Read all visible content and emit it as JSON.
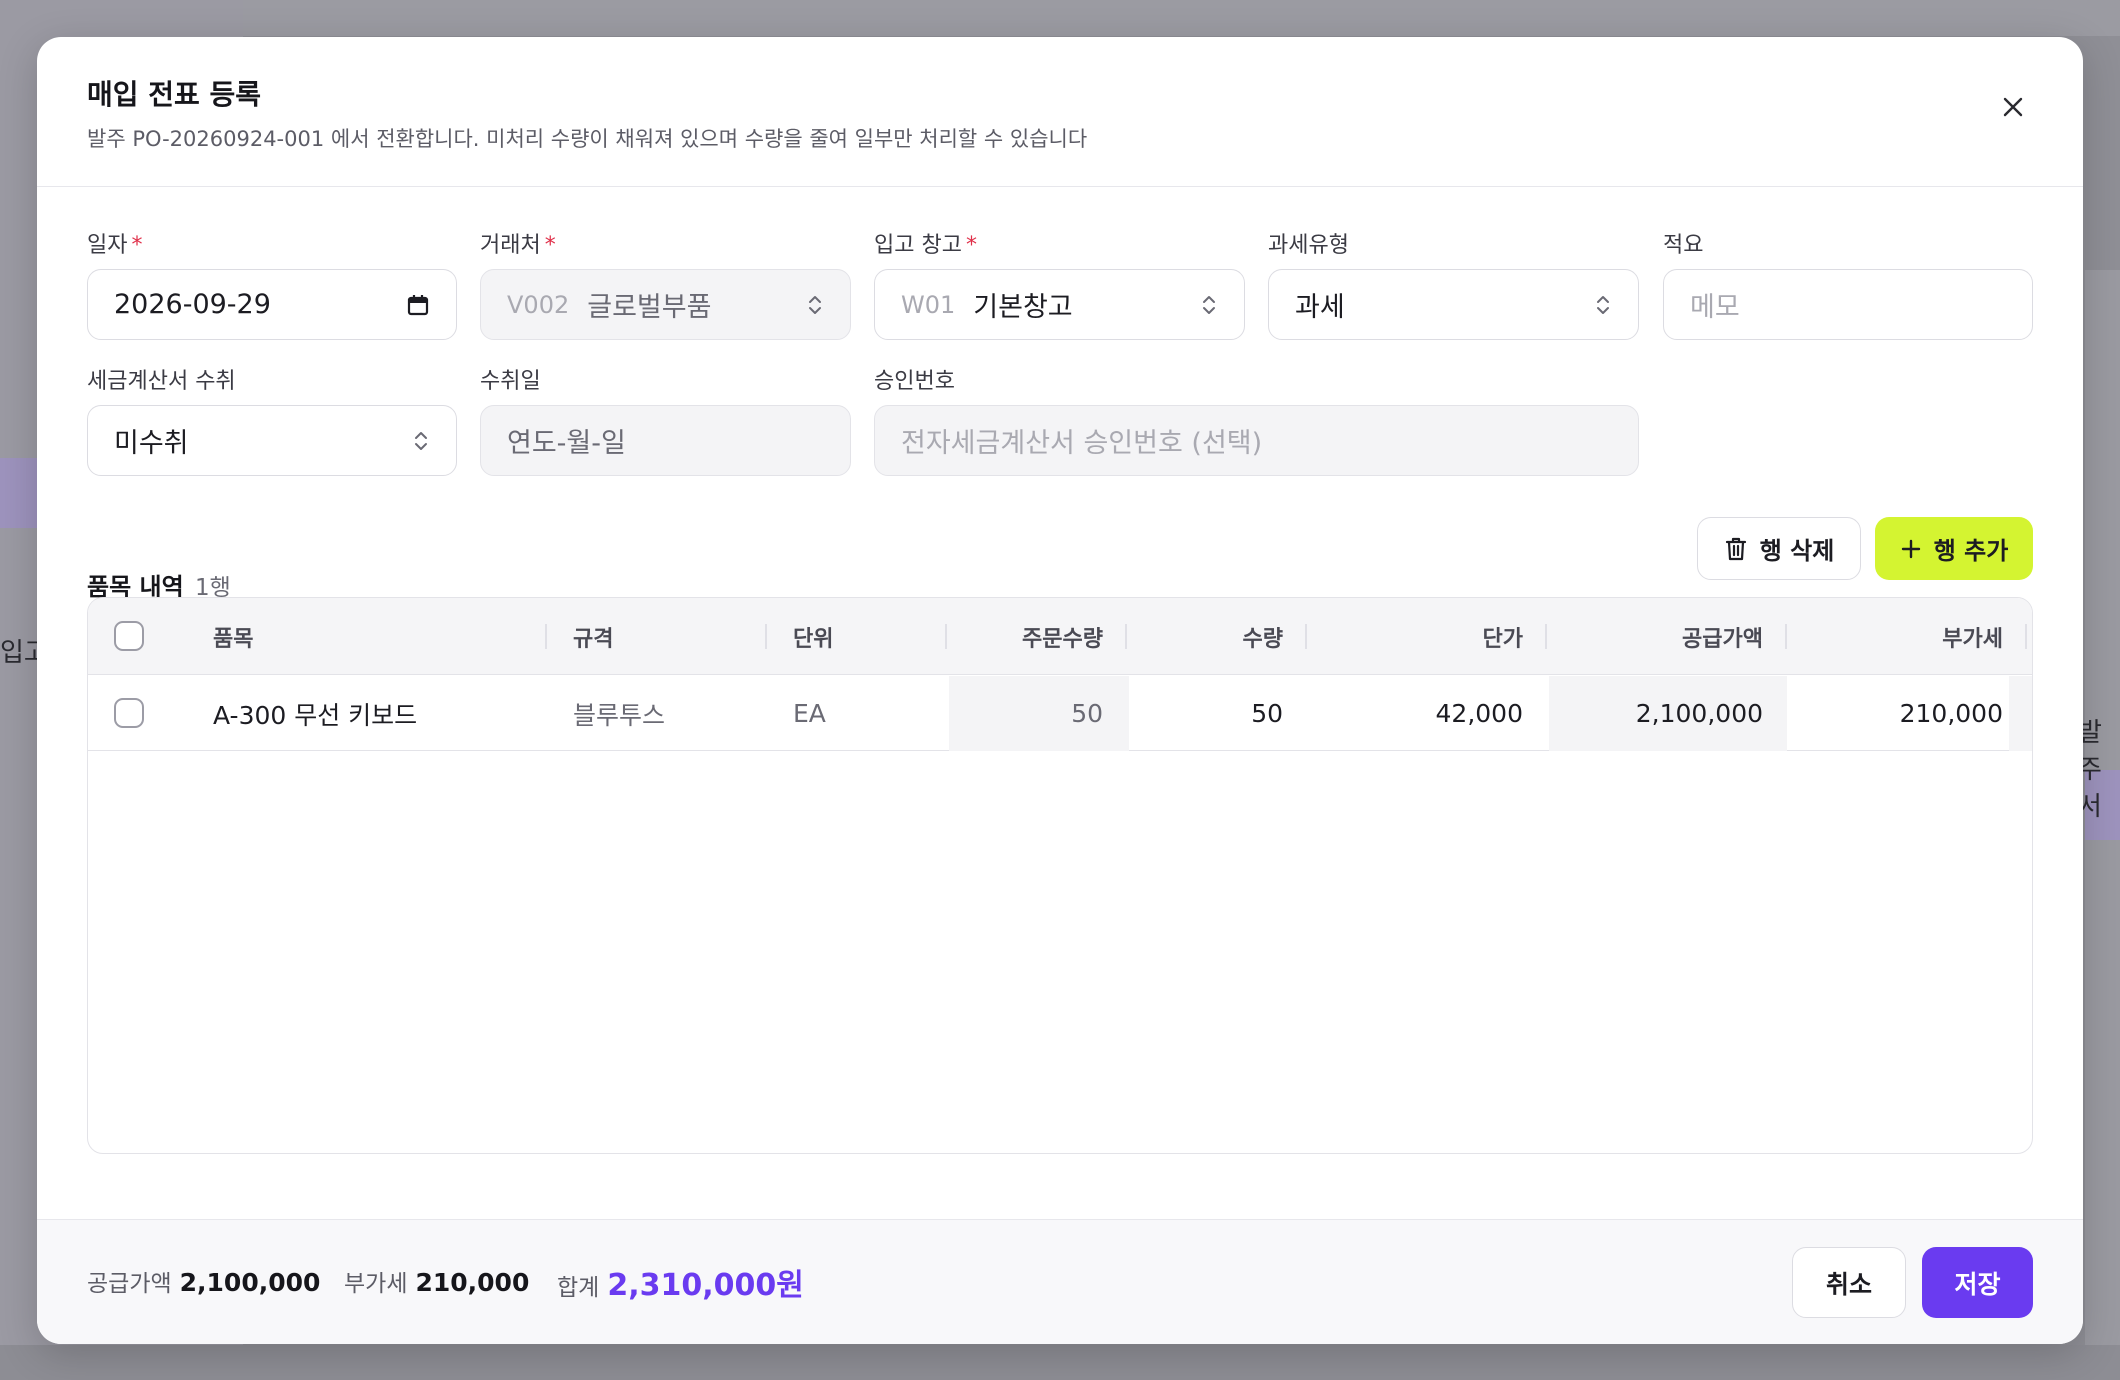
{
  "background": {
    "sidebar_fragment": "입고",
    "right_fragment": "발주서"
  },
  "modal": {
    "title": "매입 전표 등록",
    "subtitle": "발주 PO-20260924-001 에서 전환합니다. 미처리 수량이 채워져 있으며 수량을 줄여 일부만 처리할 수 있습니다",
    "close_icon": "close-icon"
  },
  "form": {
    "date": {
      "label": "일자",
      "required": "*",
      "value": "2026-09-29",
      "icon": "calendar-icon"
    },
    "vendor": {
      "label": "거래처",
      "required": "*",
      "code": "V002",
      "value": "글로벌부품",
      "icon": "chevron-updown-icon"
    },
    "warehouse": {
      "label": "입고 창고",
      "required": "*",
      "code": "W01",
      "value": "기본창고",
      "icon": "chevron-updown-icon"
    },
    "tax_type": {
      "label": "과세유형",
      "value": "과세",
      "icon": "chevron-updown-icon"
    },
    "memo": {
      "label": "적요",
      "placeholder": "메모"
    },
    "invoice_received": {
      "label": "세금계산서 수취",
      "value": "미수취",
      "icon": "chevron-updown-icon"
    },
    "received_date": {
      "label": "수취일",
      "placeholder": "연도-월-일"
    },
    "approval_no": {
      "label": "승인번호",
      "placeholder": "전자세금계산서 승인번호 (선택)"
    }
  },
  "items": {
    "title": "품목 내역",
    "count": "1행",
    "delete_label": "행 삭제",
    "add_label": "행 추가",
    "columns": [
      "품목",
      "규격",
      "단위",
      "주문수량",
      "수량",
      "단가",
      "공급가액",
      "부가세"
    ],
    "rows": [
      {
        "item": "A-300 무선 키보드",
        "spec": "블루투스",
        "unit": "EA",
        "ordered_qty": "50",
        "qty": "50",
        "unit_price": "42,000",
        "supply": "2,100,000",
        "vat": "210,000"
      }
    ]
  },
  "footer": {
    "supply_label": "공급가액",
    "supply_value": "2,100,000",
    "vat_label": "부가세",
    "vat_value": "210,000",
    "total_label": "합계",
    "total_value": "2,310,000원",
    "cancel_label": "취소",
    "save_label": "저장"
  },
  "colors": {
    "accent": "#6a3bf0",
    "add_button": "#d4f431",
    "required": "#e0304a"
  }
}
